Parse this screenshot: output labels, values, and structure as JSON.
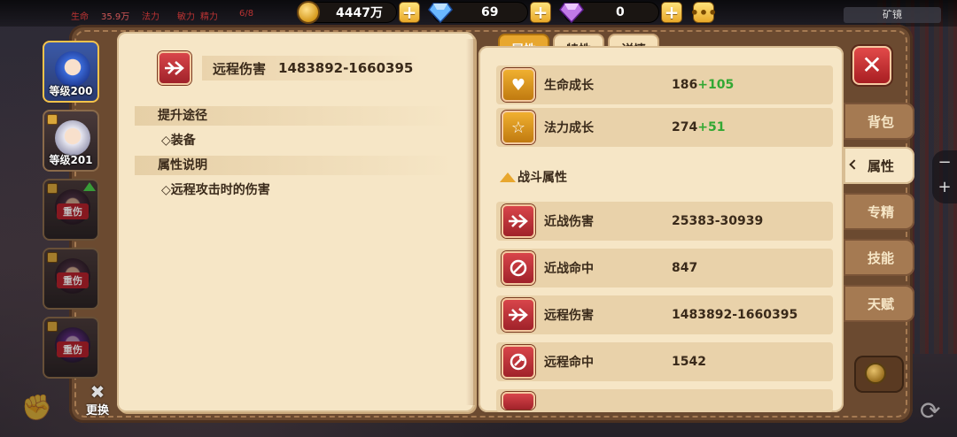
{
  "topbar": {
    "mini_stats": [
      "生命",
      "35.9万",
      "法力",
      "敏力",
      "精力",
      "6/8"
    ],
    "gold": {
      "icon": "gold-coin-icon",
      "value": "4447万"
    },
    "gem_blue": {
      "icon": "blue-diamond-icon",
      "value": "69"
    },
    "gem_purple": {
      "icon": "purple-diamond-icon",
      "value": "0"
    },
    "plus_label": "+",
    "more_label": "•••",
    "mine_label": "矿镜"
  },
  "heroes": [
    {
      "level": "等级200",
      "state": "active",
      "face": "blue"
    },
    {
      "level": "等级201",
      "state": "locked",
      "face": "white"
    },
    {
      "level": "",
      "injury": "重伤",
      "state": "injured",
      "upgrade": true,
      "face": "dark"
    },
    {
      "level": "",
      "injury": "重伤",
      "state": "injured",
      "upgrade": false,
      "face": "dark"
    },
    {
      "level": "",
      "injury": "重伤",
      "state": "injured",
      "upgrade": false,
      "face": "purple"
    }
  ],
  "swap_label": "更换",
  "detail": {
    "icon": "ranged-attack-icon",
    "title": "远程伤害",
    "value": "1483892-1660395",
    "sections": [
      {
        "heading": "提升途径",
        "items": [
          "◇装备"
        ]
      },
      {
        "heading": "属性说明",
        "items": [
          "◇远程攻击时的伤害"
        ]
      }
    ]
  },
  "tabs": [
    {
      "label": "属性",
      "active": true
    },
    {
      "label": "特性",
      "active": false
    },
    {
      "label": "详情",
      "active": false
    }
  ],
  "growth_rows": [
    {
      "name": "生命成长",
      "base": "186",
      "bonus": "+105",
      "icon": "heart-growth-icon"
    },
    {
      "name": "法力成长",
      "base": "274",
      "bonus": "+51",
      "icon": "star-growth-icon"
    }
  ],
  "combat_heading": "战斗属性",
  "combat_rows": [
    {
      "name": "近战伤害",
      "value": "25383-30939",
      "icon": "melee-damage-icon"
    },
    {
      "name": "近战命中",
      "value": "847",
      "icon": "melee-hit-icon"
    },
    {
      "name": "远程伤害",
      "value": "1483892-1660395",
      "icon": "ranged-damage-icon"
    },
    {
      "name": "远程命中",
      "value": "1542",
      "icon": "ranged-hit-icon"
    }
  ],
  "side_tabs": [
    {
      "label": "背包",
      "active": false
    },
    {
      "label": "属性",
      "active": true
    },
    {
      "label": "专精",
      "active": false
    },
    {
      "label": "技能",
      "active": false
    },
    {
      "label": "天赋",
      "active": false
    }
  ],
  "close_label": "✕",
  "zoom": {
    "minus": "−",
    "plus": "+"
  },
  "colors": {
    "accent": "#e8a72e",
    "bonus": "#33a833",
    "injury": "#b3202a",
    "close": "#d23a3a"
  }
}
